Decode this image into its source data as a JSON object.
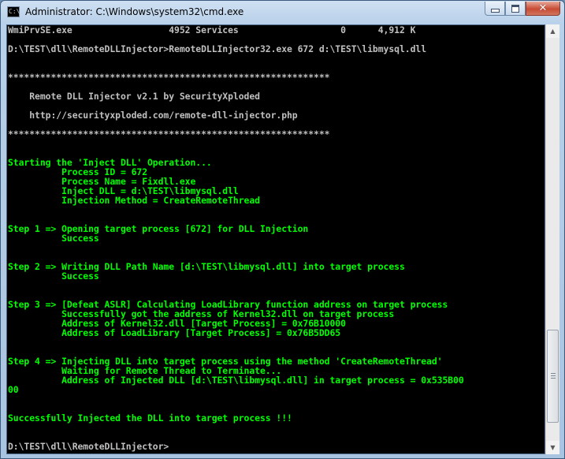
{
  "window": {
    "title": "Administrator: C:\\Windows\\system32\\cmd.exe",
    "icon_text": "C:\\"
  },
  "console_lines": [
    {
      "text": "WmiPrvSE.exe                  4952 Services                   0      4,912 K",
      "color": "gray"
    },
    {
      "text": "",
      "color": "gray"
    },
    {
      "text": "D:\\TEST\\dll\\RemoteDLLInjector>RemoteDLLInjector32.exe 672 d:\\TEST\\libmysql.dll",
      "color": "gray"
    },
    {
      "text": "",
      "color": "gray"
    },
    {
      "text": "",
      "color": "gray"
    },
    {
      "text": "************************************************************",
      "color": "gray"
    },
    {
      "text": "",
      "color": "gray"
    },
    {
      "text": "    Remote DLL Injector v2.1 by SecurityXploded",
      "color": "gray"
    },
    {
      "text": "",
      "color": "gray"
    },
    {
      "text": "    http://securityxploded.com/remote-dll-injector.php",
      "color": "gray"
    },
    {
      "text": "",
      "color": "gray"
    },
    {
      "text": "************************************************************",
      "color": "gray"
    },
    {
      "text": "",
      "color": "gray"
    },
    {
      "text": "",
      "color": "gray"
    },
    {
      "text": "Starting the 'Inject DLL' Operation...",
      "color": "green"
    },
    {
      "text": "          Process ID = 672",
      "color": "green"
    },
    {
      "text": "          Process Name = Fixdll.exe",
      "color": "green"
    },
    {
      "text": "          Inject DLL = d:\\TEST\\libmysql.dll",
      "color": "green"
    },
    {
      "text": "          Injection Method = CreateRemoteThread",
      "color": "green"
    },
    {
      "text": "",
      "color": "green"
    },
    {
      "text": "",
      "color": "green"
    },
    {
      "text": "Step 1 => Opening target process [672] for DLL Injection",
      "color": "green"
    },
    {
      "text": "          Success",
      "color": "green"
    },
    {
      "text": "",
      "color": "green"
    },
    {
      "text": "",
      "color": "green"
    },
    {
      "text": "Step 2 => Writing DLL Path Name [d:\\TEST\\libmysql.dll] into target process",
      "color": "green"
    },
    {
      "text": "          Success",
      "color": "green"
    },
    {
      "text": "",
      "color": "green"
    },
    {
      "text": "",
      "color": "green"
    },
    {
      "text": "Step 3 => [Defeat ASLR] Calculating LoadLibrary function address on target process",
      "color": "green"
    },
    {
      "text": "          Successfully got the address of Kernel32.dll on target process",
      "color": "green"
    },
    {
      "text": "          Address of Kernel32.dll [Target Process] = 0x76B10000",
      "color": "green"
    },
    {
      "text": "          Address of LoadLibrary [Target Process] = 0x76B5DD65",
      "color": "green"
    },
    {
      "text": "",
      "color": "green"
    },
    {
      "text": "",
      "color": "green"
    },
    {
      "text": "Step 4 => Injecting DLL into target process using the method 'CreateRemoteThread'",
      "color": "green"
    },
    {
      "text": "          Waiting for Remote Thread to Terminate...",
      "color": "green"
    },
    {
      "text": "          Address of Injected DLL [d:\\TEST\\libmysql.dll] in target process = 0x535B00",
      "color": "green"
    },
    {
      "text": "00",
      "color": "green"
    },
    {
      "text": "",
      "color": "green"
    },
    {
      "text": "",
      "color": "green"
    },
    {
      "text": "Successfully Injected the DLL into target process !!!",
      "color": "green"
    },
    {
      "text": "",
      "color": "green"
    },
    {
      "text": "",
      "color": "gray"
    },
    {
      "text": "D:\\TEST\\dll\\RemoteDLLInjector>",
      "color": "gray"
    }
  ]
}
